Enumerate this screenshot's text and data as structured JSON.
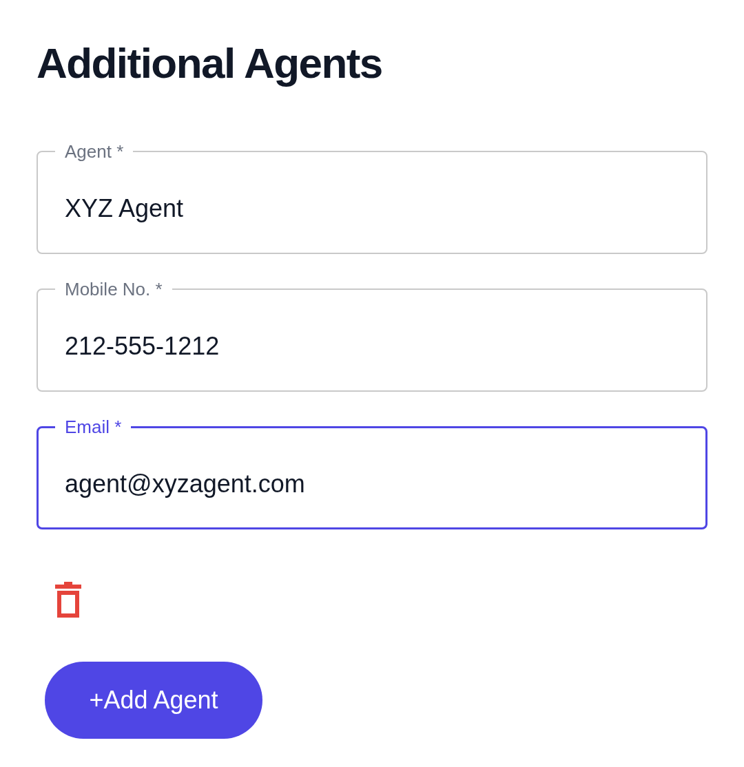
{
  "title": "Additional Agents",
  "fields": [
    {
      "label": "Agent *",
      "value": "XYZ Agent",
      "focused": false
    },
    {
      "label": "Mobile No. *",
      "value": "212-555-1212",
      "focused": false
    },
    {
      "label": "Email *",
      "value": "agent@xyzagent.com",
      "focused": true
    }
  ],
  "add_button": "+Add Agent"
}
